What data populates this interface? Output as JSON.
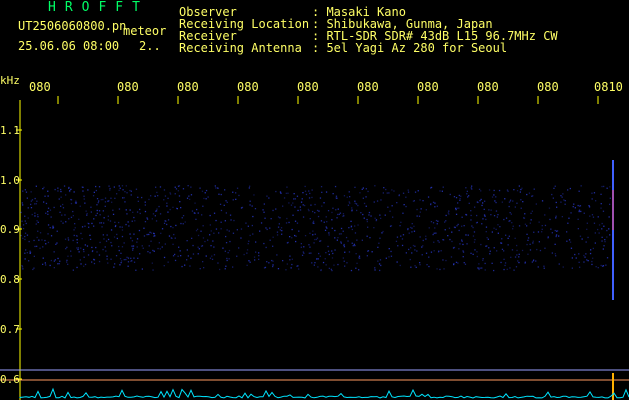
{
  "brand": "HROFFT",
  "file": {
    "name": "UT2506060800.pn",
    "label": "meteor",
    "timestamp": "25.06.06 08:00",
    "progress": "2.."
  },
  "info": [
    {
      "label": "Observer",
      "value": ": Masaki Kano"
    },
    {
      "label": "Receiving Location",
      "value": ": Shibukawa, Gunma, Japan"
    },
    {
      "label": "Receiver",
      "value": ": RTL-SDR SDR# 43dB L15 96.7MHz CW"
    },
    {
      "label": "Receiving Antenna",
      "value": ": 5el Yagi Az 280 for Seoul"
    }
  ],
  "axis": {
    "unit": "kHz",
    "y_ticks": [
      "1.1",
      "1.0",
      "0.9",
      "0.8",
      "0.7",
      "0.6"
    ],
    "x_ticks": [
      "080",
      "080",
      "080",
      "080",
      "080",
      "080",
      "080",
      "080",
      "080",
      "0810"
    ]
  },
  "colors": {
    "text": "#ffff66",
    "brand": "#00ff66",
    "grid": "#ffff00",
    "noise": "#2a3ad0",
    "baseline": "#00e5ff",
    "marker": "#ffb000"
  }
}
